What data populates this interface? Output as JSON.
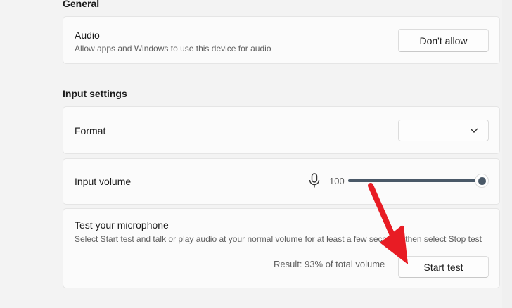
{
  "general": {
    "heading": "General",
    "audio": {
      "title": "Audio",
      "description": "Allow apps and Windows to use this device for audio",
      "button": "Don't allow"
    }
  },
  "input_settings": {
    "heading": "Input settings",
    "format": {
      "title": "Format",
      "value": ""
    },
    "input_volume": {
      "title": "Input volume",
      "value": "100",
      "fraction": 1.0
    },
    "test": {
      "title": "Test your microphone",
      "description": "Select Start test and talk or play audio at your normal volume for at least a few seconds, then select Stop test",
      "result": "Result: 93% of total volume",
      "button": "Start test"
    }
  },
  "colors": {
    "slider": "#4a5968",
    "arrow": "#e81c24"
  }
}
